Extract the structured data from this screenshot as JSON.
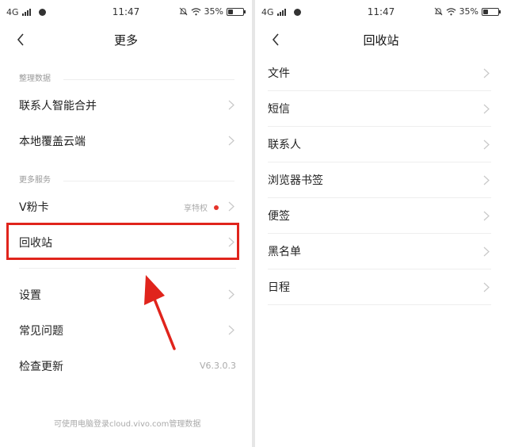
{
  "status_bar": {
    "network": "4G",
    "time": "11:47",
    "battery": "35%",
    "battery_fill": 0.35
  },
  "left_screen": {
    "title": "更多",
    "sections": [
      {
        "header": "整理数据",
        "items": [
          "联系人智能合并",
          "本地覆盖云端"
        ]
      },
      {
        "header": "更多服务",
        "items": [
          "V粉卡",
          "回收站"
        ]
      }
    ],
    "vcard_extra": "享特权",
    "settings_items": [
      "设置",
      "常见问题",
      "检查更新"
    ],
    "version": "V6.3.0.3",
    "footer_note": "可使用电脑登录cloud.vivo.com管理数据"
  },
  "right_screen": {
    "title": "回收站",
    "items": [
      "文件",
      "短信",
      "联系人",
      "浏览器书签",
      "便签",
      "黑名单",
      "日程"
    ]
  },
  "colors": {
    "accent_red": "#e0241c",
    "dot_red": "#e5332a",
    "text": "#222222",
    "muted": "#999999"
  }
}
